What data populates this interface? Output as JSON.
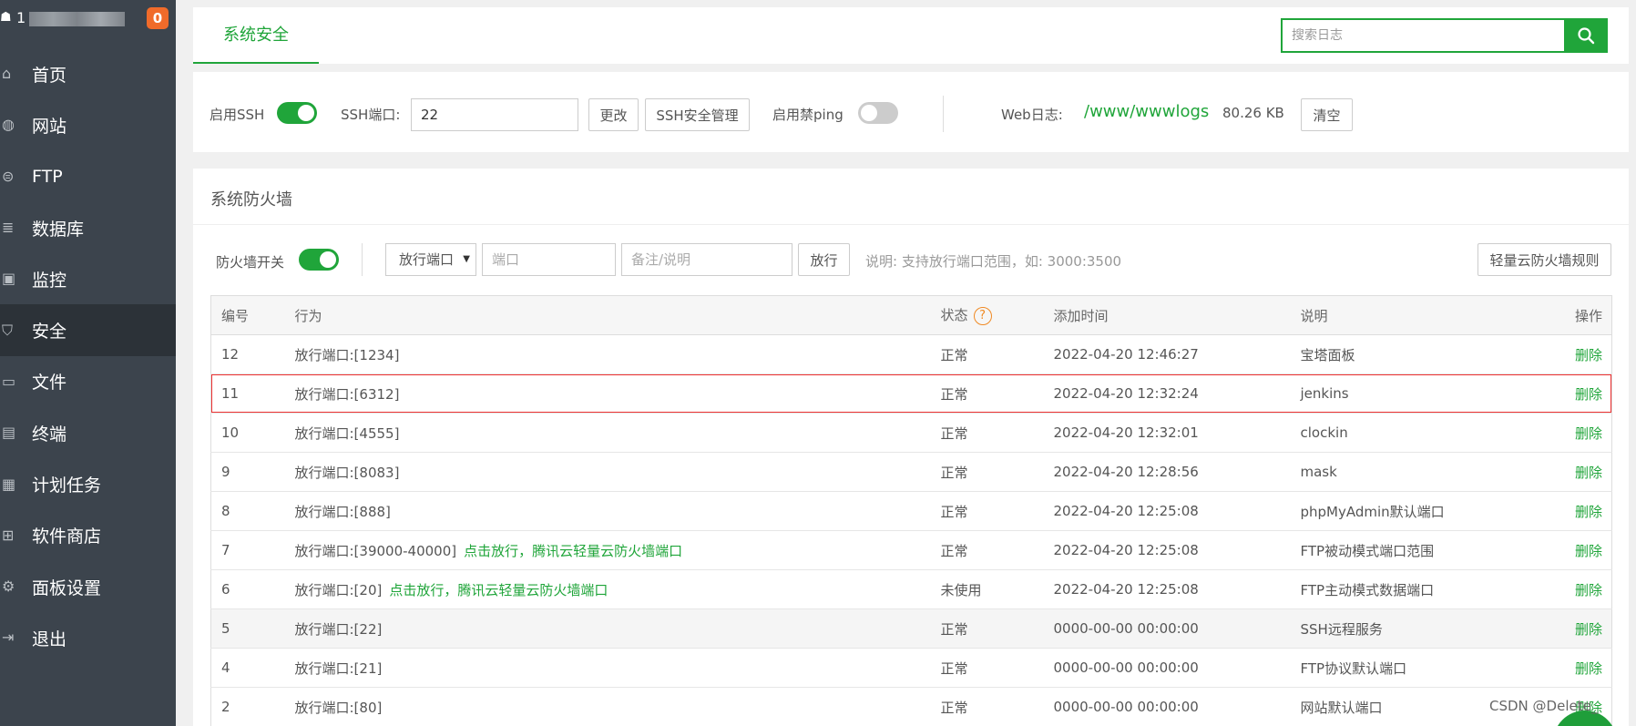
{
  "sidebar": {
    "host_initial": "1",
    "badge": "0",
    "items": [
      {
        "label": "首页",
        "icon": "home-icon",
        "glyph": "⌂"
      },
      {
        "label": "网站",
        "icon": "globe-icon",
        "glyph": "◍"
      },
      {
        "label": "FTP",
        "icon": "ftp-icon",
        "glyph": "⊜"
      },
      {
        "label": "数据库",
        "icon": "database-icon",
        "glyph": "≣"
      },
      {
        "label": "监控",
        "icon": "monitor-icon",
        "glyph": "▣"
      },
      {
        "label": "安全",
        "icon": "shield-icon",
        "glyph": "⛉"
      },
      {
        "label": "文件",
        "icon": "folder-icon",
        "glyph": "▭"
      },
      {
        "label": "终端",
        "icon": "terminal-icon",
        "glyph": "▤"
      },
      {
        "label": "计划任务",
        "icon": "calendar-icon",
        "glyph": "▦"
      },
      {
        "label": "软件商店",
        "icon": "apps-icon",
        "glyph": "⊞"
      },
      {
        "label": "面板设置",
        "icon": "gear-icon",
        "glyph": "⚙"
      },
      {
        "label": "退出",
        "icon": "logout-icon",
        "glyph": "⇥"
      }
    ],
    "active_index": 5
  },
  "topbar": {
    "tab_label": "系统安全",
    "search_placeholder": "搜索日志"
  },
  "ssh": {
    "enable_ssh_label": "启用SSH",
    "enable_ssh": true,
    "port_label": "SSH端口:",
    "port_value": "22",
    "change_button": "更改",
    "manage_button": "SSH安全管理",
    "ping_label": "启用禁ping",
    "ping_enabled": false,
    "web_log_label": "Web日志:",
    "web_log_path": "/www/wwwlogs",
    "web_log_size": "80.26 KB",
    "clear_button": "清空"
  },
  "firewall": {
    "title": "系统防火墙",
    "switch_label": "防火墙开关",
    "switch_on": true,
    "action_select": "放行端口",
    "port_placeholder": "端口",
    "remark_placeholder": "备注/说明",
    "allow_button": "放行",
    "note": "说明: 支持放行端口范围，如: 3000:3500",
    "rules_button": "轻量云防火墙规则",
    "columns": {
      "id": "编号",
      "action": "行为",
      "status": "状态",
      "status_help": "?",
      "added": "添加时间",
      "desc": "说明",
      "op": "操作"
    },
    "rows": [
      {
        "id": "12",
        "action": "放行端口:[1234]",
        "hint": "",
        "status": "正常",
        "added": "2022-04-20 12:46:27",
        "desc": "宝塔面板",
        "op": "删除"
      },
      {
        "id": "11",
        "action": "放行端口:[6312]",
        "hint": "",
        "status": "正常",
        "added": "2022-04-20 12:32:24",
        "desc": "jenkins",
        "op": "删除"
      },
      {
        "id": "10",
        "action": "放行端口:[4555]",
        "hint": "",
        "status": "正常",
        "added": "2022-04-20 12:32:01",
        "desc": "clockin",
        "op": "删除"
      },
      {
        "id": "9",
        "action": "放行端口:[8083]",
        "hint": "",
        "status": "正常",
        "added": "2022-04-20 12:28:56",
        "desc": "mask",
        "op": "删除"
      },
      {
        "id": "8",
        "action": "放行端口:[888]",
        "hint": "",
        "status": "正常",
        "added": "2022-04-20 12:25:08",
        "desc": "phpMyAdmin默认端口",
        "op": "删除"
      },
      {
        "id": "7",
        "action": "放行端口:[39000-40000]",
        "hint": "点击放行，腾讯云轻量云防火墙端口",
        "status": "正常",
        "added": "2022-04-20 12:25:08",
        "desc": "FTP被动模式端口范围",
        "op": "删除"
      },
      {
        "id": "6",
        "action": "放行端口:[20]",
        "hint": "点击放行，腾讯云轻量云防火墙端口",
        "status": "未使用",
        "added": "2022-04-20 12:25:08",
        "desc": "FTP主动模式数据端口",
        "op": "删除"
      },
      {
        "id": "5",
        "action": "放行端口:[22]",
        "hint": "",
        "status": "正常",
        "added": "0000-00-00 00:00:00",
        "desc": "SSH远程服务",
        "op": "删除"
      },
      {
        "id": "4",
        "action": "放行端口:[21]",
        "hint": "",
        "status": "正常",
        "added": "0000-00-00 00:00:00",
        "desc": "FTP协议默认端口",
        "op": "删除"
      },
      {
        "id": "2",
        "action": "放行端口:[80]",
        "hint": "",
        "status": "正常",
        "added": "0000-00-00 00:00:00",
        "desc": "网站默认端口",
        "op": "删除"
      }
    ],
    "highlighted_row_id": "11",
    "hover_row_id": "5"
  },
  "watermark": "CSDN @Delete_",
  "colors": {
    "accent": "#20a53a",
    "sidebar": "#3c444d",
    "badge": "#f06b2a",
    "highlight_border": "#ee3333"
  }
}
